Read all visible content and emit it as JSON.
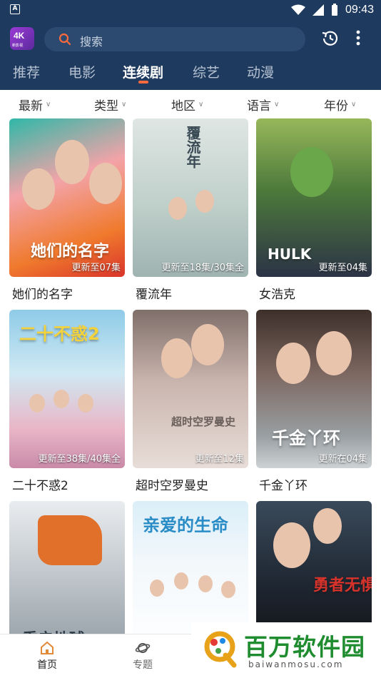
{
  "status_bar": {
    "time": "09:43"
  },
  "header": {
    "logo_text": "4K",
    "logo_sub": "新影视",
    "search_placeholder": "搜索"
  },
  "tabs": [
    {
      "label": "推荐",
      "active": false
    },
    {
      "label": "电影",
      "active": false
    },
    {
      "label": "连续剧",
      "active": true
    },
    {
      "label": "综艺",
      "active": false
    },
    {
      "label": "动漫",
      "active": false
    }
  ],
  "filters": [
    "最新",
    "类型",
    "地区",
    "语言",
    "年份"
  ],
  "cards": [
    {
      "title": "她们的名字",
      "episodes": "更新至07集",
      "poster_text": "她们的名字"
    },
    {
      "title": "覆流年",
      "episodes": "更新至18集/30集全",
      "poster_text": "覆流年"
    },
    {
      "title": "女浩克",
      "episodes": "更新至04集",
      "poster_text": "HULK"
    },
    {
      "title": "二十不惑2",
      "episodes": "更新至38集/40集全",
      "poster_text": "二十不惑2"
    },
    {
      "title": "超时空罗曼史",
      "episodes": "更新至12集",
      "poster_text": "超时空罗曼史"
    },
    {
      "title": "千金丫环",
      "episodes": "更新在04集",
      "poster_text": "千金丫环"
    },
    {
      "title": "重启地球",
      "episodes": "",
      "poster_text": "重启地球"
    },
    {
      "title": "亲爱的生命",
      "episodes": "",
      "poster_text": "亲爱的生命"
    },
    {
      "title": "勇者无惧",
      "episodes": "",
      "poster_text": "勇者无惧"
    }
  ],
  "bottom_nav": [
    {
      "label": "首页",
      "active": true
    },
    {
      "label": "专题",
      "active": false
    }
  ],
  "watermark": {
    "title": "百万软件园",
    "sub": "baiwanmosu.com"
  },
  "colors": {
    "header_bg": "#1e3a5f",
    "tab_indicator": "#ff6a3d",
    "watermark_green": "#1f8c2f"
  }
}
